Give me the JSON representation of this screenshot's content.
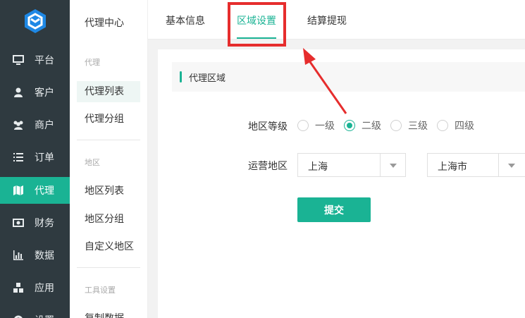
{
  "sidebar": {
    "items": [
      {
        "label": "平台",
        "icon": "monitor-icon"
      },
      {
        "label": "客户",
        "icon": "user-icon"
      },
      {
        "label": "商户",
        "icon": "users-icon"
      },
      {
        "label": "订单",
        "icon": "list-icon"
      },
      {
        "label": "代理",
        "icon": "map-icon",
        "active": true
      },
      {
        "label": "财务",
        "icon": "money-icon"
      },
      {
        "label": "数据",
        "icon": "bar-chart-icon"
      },
      {
        "label": "应用",
        "icon": "cubes-icon"
      },
      {
        "label": "设置",
        "icon": "gear-icon"
      }
    ]
  },
  "subnav": {
    "title": "代理中心",
    "group_agent": "代理",
    "agent_list": "代理列表",
    "agent_group": "代理分组",
    "group_region": "地区",
    "region_list": "地区列表",
    "region_group": "地区分组",
    "custom_region": "自定义地区",
    "group_tools": "工具设置",
    "copy_data": "复制数据"
  },
  "tabs": [
    {
      "label": "基本信息"
    },
    {
      "label": "区域设置",
      "active": true
    },
    {
      "label": "结算提现"
    }
  ],
  "section": {
    "title": "代理区域"
  },
  "form": {
    "level_label": "地区等级",
    "levels": [
      "一级",
      "二级",
      "三级",
      "四级"
    ],
    "selected_level": "二级",
    "region_label": "运营地区",
    "province": "上海",
    "city": "上海市",
    "submit_label": "提交"
  },
  "colors": {
    "accent": "#1ab394",
    "sidebar_bg": "#2f3a40",
    "annotation": "#e62d2d"
  }
}
